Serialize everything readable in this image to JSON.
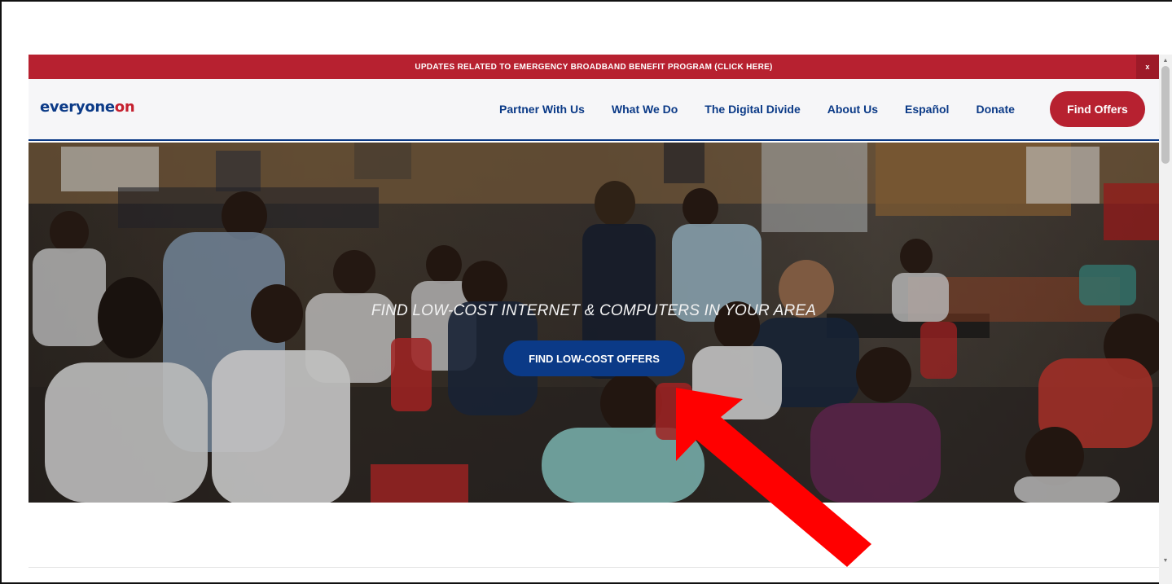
{
  "banner": {
    "text": "UPDATES RELATED TO  EMERGENCY BROADBAND BENEFIT PROGRAM (CLICK HERE)",
    "close_label": "x"
  },
  "header": {
    "logo_part1": "everyone",
    "logo_part2": "on",
    "nav": [
      {
        "label": "Partner With Us"
      },
      {
        "label": "What We Do"
      },
      {
        "label": "The Digital Divide"
      },
      {
        "label": "About Us"
      },
      {
        "label": "Español"
      },
      {
        "label": "Donate"
      }
    ],
    "cta_label": "Find Offers"
  },
  "hero": {
    "title": "FIND LOW-COST INTERNET & COMPUTERS IN YOUR AREA",
    "button_label": "FIND LOW-COST OFFERS"
  },
  "colors": {
    "brand_red": "#b72130",
    "brand_blue": "#0b3a87",
    "annotation_arrow": "#ff0000"
  },
  "icons": {
    "scroll_up": "chevron-up-icon",
    "scroll_down": "chevron-down-icon",
    "annotation": "red-arrow-icon"
  }
}
